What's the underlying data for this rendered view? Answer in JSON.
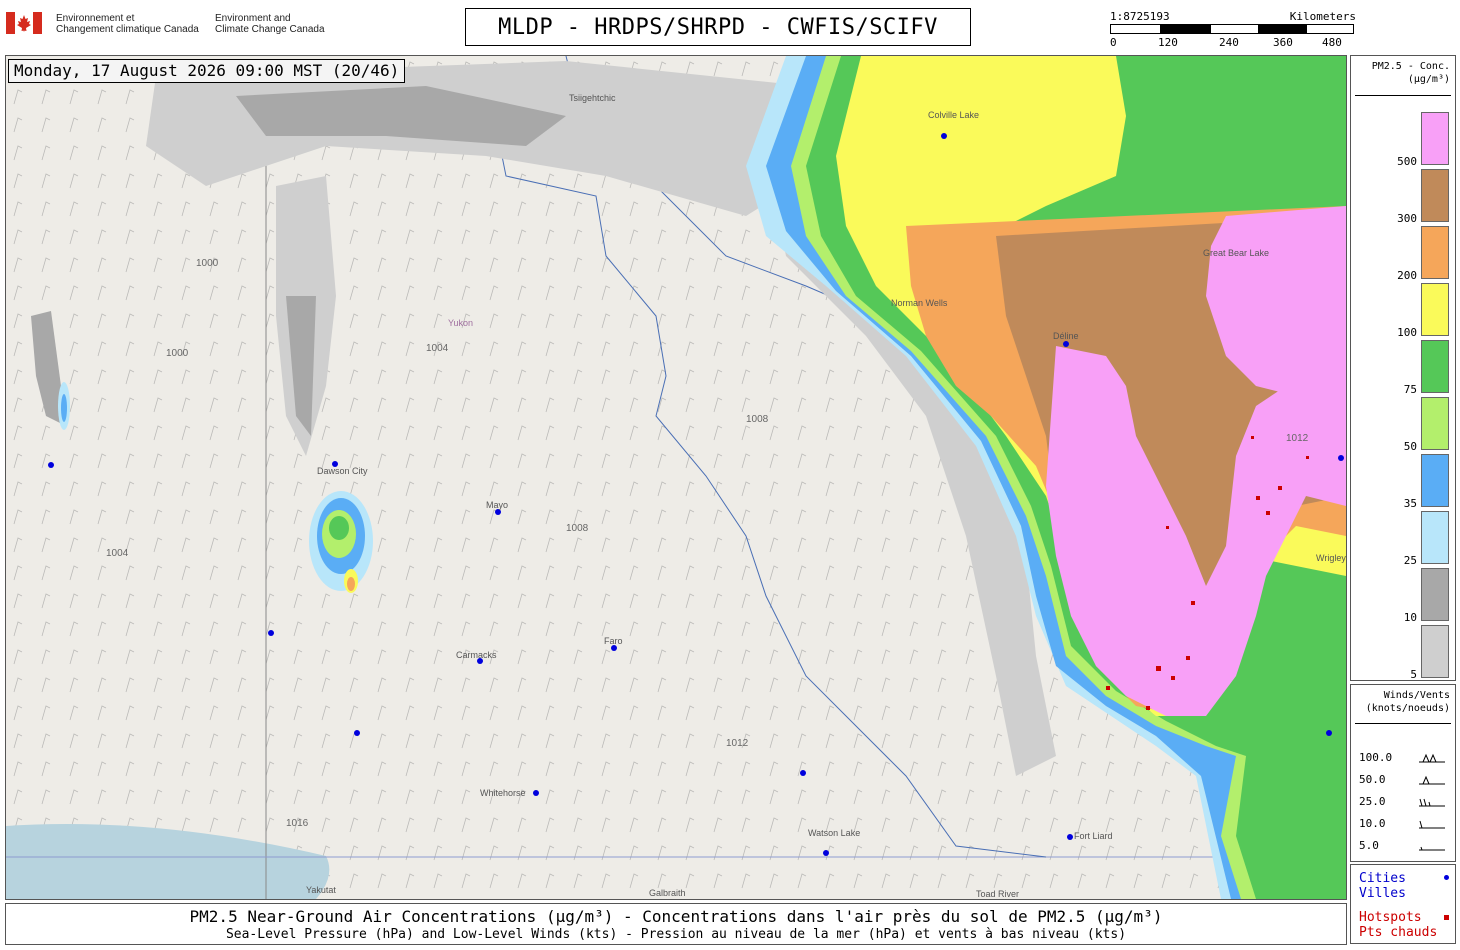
{
  "header": {
    "title": "MLDP - HRDPS/SHRPD - CWFIS/SCIFV",
    "gov_fr_line1": "Environnement et",
    "gov_fr_line2": "Changement climatique Canada",
    "gov_en_line1": "Environment and",
    "gov_en_line2": "Climate Change Canada",
    "logo_icon": "canada-flag-icon"
  },
  "scale_bar": {
    "ratio": "1:8725193",
    "unit": "Kilometers",
    "ticks": [
      "0",
      "120",
      "240",
      "360",
      "480"
    ]
  },
  "map": {
    "timestamp": "Monday, 17 August 2026 09:00 MST (20/46)",
    "places": [
      "Tsiigehtchic",
      "Colville Lake",
      "Norman Wells",
      "Déline",
      "Great Bear Lake",
      "Yukon",
      "Dawson City",
      "Mayo",
      "Faro",
      "Carmacks",
      "Whitehorse",
      "Watson Lake",
      "Fort Liard",
      "Wrigley",
      "Yakutat",
      "Toad River",
      "Galbraith"
    ],
    "isobars": [
      "1000",
      "1004",
      "1008",
      "1012",
      "1016"
    ],
    "colors": {
      "land": "#eeece7",
      "water": "#b7d3de",
      "pm_5": "#cfcfcf",
      "pm_10": "#a8a8a8",
      "pm_25": "#b8e6fa",
      "pm_35": "#5aadf5",
      "pm_50": "#b3ef6c",
      "pm_75": "#55c858",
      "pm_100": "#fafa5a",
      "pm_200": "#f5a65a",
      "pm_300": "#c08a5a",
      "pm_500": "#f8a0f7",
      "city": "#0000dd",
      "hotspot": "#cc0000"
    }
  },
  "legend_pm": {
    "title_line1": "PM2.5 - Conc.",
    "title_line2": "(µg/m³)",
    "levels": [
      {
        "value": "500",
        "color": "#f8a0f7"
      },
      {
        "value": "300",
        "color": "#c08a5a"
      },
      {
        "value": "200",
        "color": "#f5a65a"
      },
      {
        "value": "100",
        "color": "#fafa5a"
      },
      {
        "value": "75",
        "color": "#55c858"
      },
      {
        "value": "50",
        "color": "#b3ef6c"
      },
      {
        "value": "35",
        "color": "#5aadf5"
      },
      {
        "value": "25",
        "color": "#b8e6fa"
      },
      {
        "value": "10",
        "color": "#a8a8a8"
      },
      {
        "value": "5",
        "color": "#cfcfcf"
      }
    ]
  },
  "legend_wind": {
    "title_line1": "Winds/Vents",
    "title_line2": "(knots/noeuds)",
    "rows": [
      {
        "label": "100.0",
        "icon": "wind-barb-100-icon"
      },
      {
        "label": "50.0",
        "icon": "wind-barb-50-icon"
      },
      {
        "label": "25.0",
        "icon": "wind-barb-25-icon"
      },
      {
        "label": "10.0",
        "icon": "wind-barb-10-icon"
      },
      {
        "label": "5.0",
        "icon": "wind-barb-5-icon"
      }
    ]
  },
  "legend_symbols": {
    "cities_en": "Cities",
    "cities_fr": "Villes",
    "hotspots_en": "Hotspots",
    "hotspots_fr": "Pts chauds"
  },
  "footer": {
    "line1": "PM2.5 Near-Ground Air Concentrations (µg/m³) - Concentrations dans l'air près du sol de PM2.5 (µg/m³)",
    "line2": "Sea-Level Pressure (hPa) and Low-Level Winds (kts) - Pression au niveau de la mer (hPa) et vents à bas niveau (kts)"
  }
}
